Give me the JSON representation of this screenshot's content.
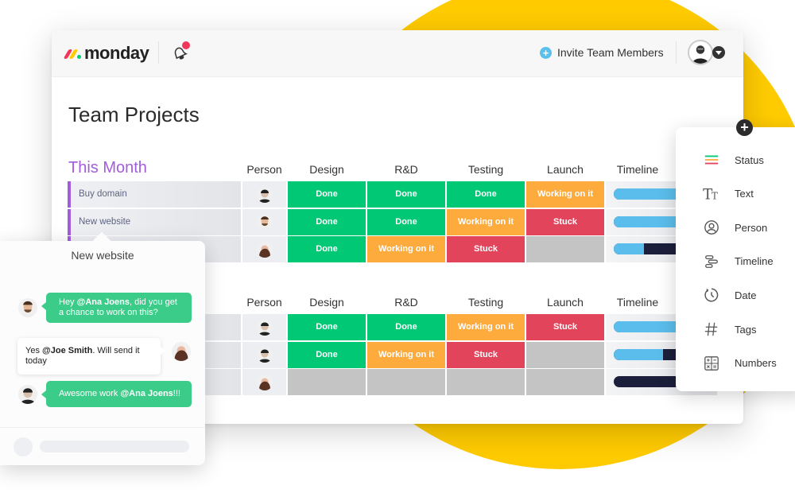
{
  "brand": {
    "name": "monday",
    "logo_colors": [
      "#f0365a",
      "#ffcb00",
      "#00ca72"
    ],
    "accent_yellow": "#ffcb00"
  },
  "topbar": {
    "invite_label": "Invite Team Members",
    "notification_badge": true
  },
  "page": {
    "title": "Team Projects"
  },
  "columns": [
    "Person",
    "Design",
    "R&D",
    "Testing",
    "Launch",
    "Timeline"
  ],
  "status_colors": {
    "Done": "#00c875",
    "Working on it": "#fdab3d",
    "Stuck": "#e2445c",
    "": "#c4c4c4"
  },
  "groups": [
    {
      "title": "This Month",
      "color": "#a25ddc",
      "rows": [
        {
          "name": "Buy domain",
          "person": "man-dark-hair",
          "statuses": [
            "Done",
            "Done",
            "Done",
            "Working on it"
          ],
          "timeline_progress": 1.0
        },
        {
          "name": "New website",
          "person": "man-beard",
          "statuses": [
            "Done",
            "Done",
            "Working on it",
            "Stuck"
          ],
          "timeline_progress": 0.85
        },
        {
          "name": "",
          "person": "woman-long-hair",
          "statuses": [
            "Done",
            "Working on it",
            "Stuck",
            ""
          ],
          "timeline_progress": 0.4
        }
      ]
    },
    {
      "title": "",
      "color": "#a25ddc",
      "rows": [
        {
          "name": "",
          "person": "man-dark-hair",
          "statuses": [
            "Done",
            "Done",
            "Working on it",
            "Stuck"
          ],
          "timeline_progress": 1.0
        },
        {
          "name": "",
          "person": "man-dark-hair",
          "statuses": [
            "Done",
            "Working on it",
            "Stuck",
            ""
          ],
          "timeline_progress": 0.65
        },
        {
          "name": "",
          "person": "woman-long-hair",
          "statuses": [
            "",
            "",
            "",
            ""
          ],
          "timeline_progress": 0.0
        }
      ]
    }
  ],
  "column_picker": {
    "items": [
      {
        "label": "Status",
        "icon": "status-lines-icon"
      },
      {
        "label": "Text",
        "icon": "text-icon"
      },
      {
        "label": "Person",
        "icon": "person-icon"
      },
      {
        "label": "Timeline",
        "icon": "timeline-icon"
      },
      {
        "label": "Date",
        "icon": "clock-icon"
      },
      {
        "label": "Tags",
        "icon": "hash-icon"
      },
      {
        "label": "Numbers",
        "icon": "calculator-icon"
      }
    ]
  },
  "chat": {
    "title": "New website",
    "messages": [
      {
        "side": "left",
        "pre": "Hey ",
        "mention": "@Ana Joens",
        "post": ", did you get a chance to work on this?"
      },
      {
        "side": "right",
        "pre": "Yes ",
        "mention": "@Joe Smith",
        "post": ". Will send it today"
      },
      {
        "side": "left",
        "pre": "Awesome work ",
        "mention": "@Ana Joens",
        "post": "!!!"
      }
    ],
    "input_placeholder": ""
  }
}
